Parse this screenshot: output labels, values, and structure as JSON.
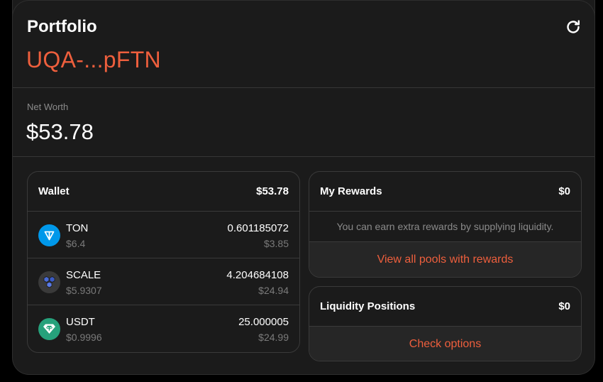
{
  "header": {
    "title": "Portfolio",
    "address": "UQA-...pFTN",
    "refresh_icon": "refresh-icon"
  },
  "net_worth": {
    "label": "Net Worth",
    "value": "$53.78"
  },
  "wallet": {
    "title": "Wallet",
    "total": "$53.78",
    "assets": [
      {
        "name": "TON",
        "price": "$6.4",
        "amount": "0.601185072",
        "usd": "$3.85",
        "icon": "ton-icon"
      },
      {
        "name": "SCALE",
        "price": "$5.9307",
        "amount": "4.204684108",
        "usd": "$24.94",
        "icon": "scale-icon"
      },
      {
        "name": "USDT",
        "price": "$0.9996",
        "amount": "25.000005",
        "usd": "$24.99",
        "icon": "usdt-icon"
      }
    ]
  },
  "rewards": {
    "title": "My Rewards",
    "value": "$0",
    "message": "You can earn extra rewards by supplying liquidity.",
    "button": "View all pools with rewards"
  },
  "liquidity": {
    "title": "Liquidity Positions",
    "value": "$0",
    "button": "Check options"
  },
  "colors": {
    "accent": "#ee5f3d",
    "background": "#1b1b1b",
    "ton": "#0098ea",
    "usdt": "#26a17b"
  }
}
